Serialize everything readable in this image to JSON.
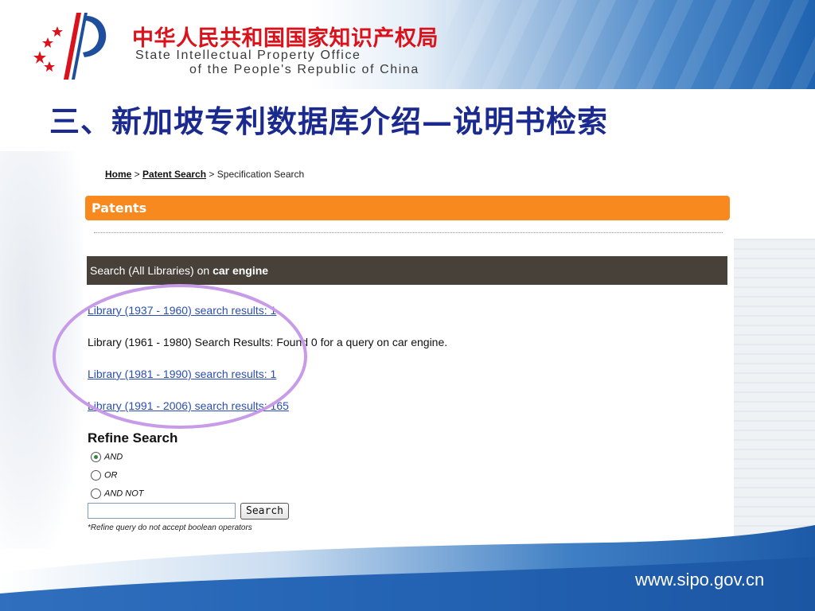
{
  "header": {
    "org_cn": "中华人民共和国国家知识产权局",
    "org_en_line1": "State Intellectual Property Office",
    "org_en_line2": "of the People's Republic of China"
  },
  "slide": {
    "title": "三、新加坡专利数据库介绍—说明书检索",
    "footer_url": "www.sipo.gov.cn"
  },
  "page": {
    "breadcrumb": {
      "home": "Home",
      "sep1": " > ",
      "patent_search": "Patent Search",
      "sep2": " > ",
      "current": "Specification Search"
    },
    "section_header": "Patents",
    "results_header": {
      "prefix": "Search (All Libraries) on ",
      "query": "car engine"
    },
    "libraries": [
      "Library (1937 - 1960) search results: 1",
      "Library (1961 - 1980) Search Results: Found 0 for a query on car engine.",
      "Library (1981 - 1990) search results: 1",
      "Library (1991 - 2006) search results: 165"
    ],
    "refine": {
      "title": "Refine Search",
      "options": [
        "AND",
        "OR",
        "AND NOT"
      ],
      "selected": "AND",
      "input_value": "",
      "button": "Search",
      "note": "*Refine query do not accept boolean operators"
    }
  },
  "colors": {
    "title_blue": "#1b2a8f",
    "org_red": "#d9121b",
    "orange_bar": "#f7891f",
    "dark_bar": "#47413a",
    "link_blue": "#2a4fb0",
    "annotation_purple": "#c79be8"
  }
}
